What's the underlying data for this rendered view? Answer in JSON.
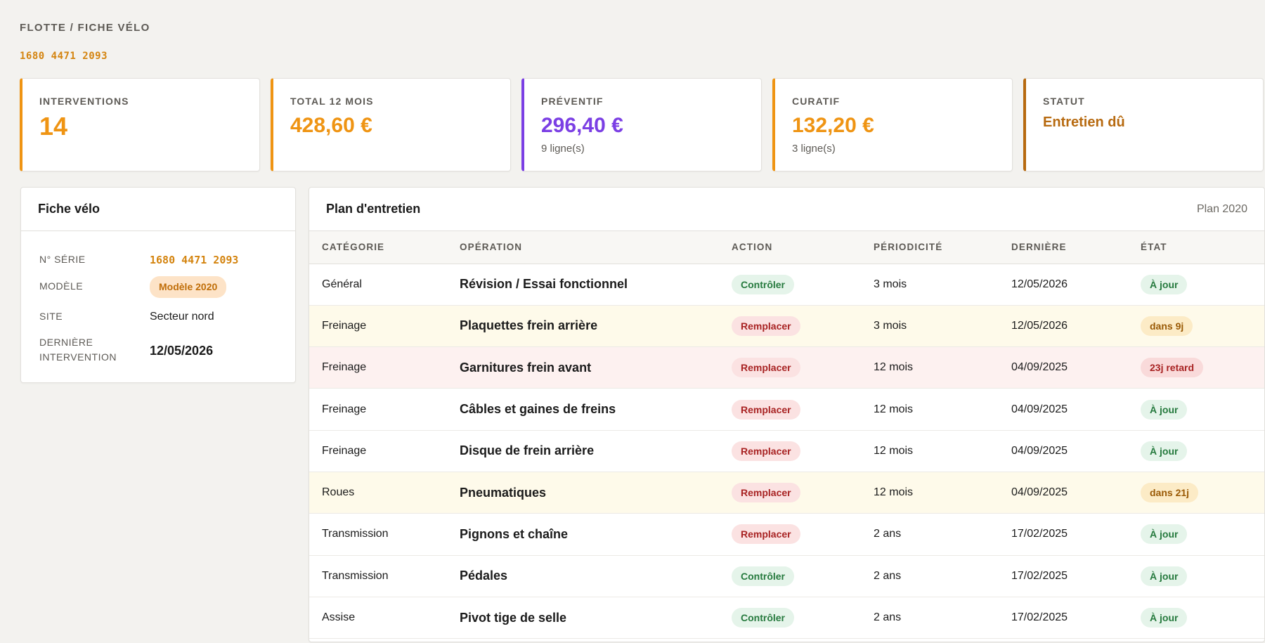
{
  "breadcrumb": "FLOTTE / FICHE VÉLO",
  "serial_header": "1680 4471 2093",
  "kpis": {
    "interventions": {
      "label": "INTERVENTIONS",
      "value": "14"
    },
    "total": {
      "label": "TOTAL 12 MOIS",
      "value": "428,60 €"
    },
    "preventif": {
      "label": "PRÉVENTIF",
      "value": "296,40 €",
      "sub": "9 ligne(s)"
    },
    "curatif": {
      "label": "CURATIF",
      "value": "132,20 €",
      "sub": "3 ligne(s)"
    },
    "statut": {
      "label": "STATUT",
      "value": "Entretien dû"
    }
  },
  "fiche": {
    "title": "Fiche vélo",
    "serie_label": "N° SÉRIE",
    "serie_value": "1680 4471 2093",
    "modele_label": "MODÈLE",
    "modele_value": "Modèle 2020",
    "site_label": "SITE",
    "site_value": "Secteur nord",
    "derniere_label": "DERNIÈRE INTERVENTION",
    "derniere_value": "12/05/2026"
  },
  "plan": {
    "title": "Plan d'entretien",
    "meta": "Plan 2020",
    "columns": [
      "CATÉGORIE",
      "OPÉRATION",
      "ACTION",
      "PÉRIODICITÉ",
      "DERNIÈRE",
      "ÉTAT"
    ],
    "rows": [
      {
        "categorie": "Général",
        "operation": "Révision / Essai fonctionnel",
        "action": "Contrôler",
        "periodicite": "3 mois",
        "derniere": "12/05/2026",
        "etat": "À jour"
      },
      {
        "categorie": "Freinage",
        "operation": "Plaquettes frein arrière",
        "action": "Remplacer",
        "periodicite": "3 mois",
        "derniere": "12/05/2026",
        "etat": "dans 9j"
      },
      {
        "categorie": "Freinage",
        "operation": "Garnitures frein avant",
        "action": "Remplacer",
        "periodicite": "12 mois",
        "derniere": "04/09/2025",
        "etat": "23j retard"
      },
      {
        "categorie": "Freinage",
        "operation": "Câbles et gaines de freins",
        "action": "Remplacer",
        "periodicite": "12 mois",
        "derniere": "04/09/2025",
        "etat": "À jour"
      },
      {
        "categorie": "Freinage",
        "operation": "Disque de frein arrière",
        "action": "Remplacer",
        "periodicite": "12 mois",
        "derniere": "04/09/2025",
        "etat": "À jour"
      },
      {
        "categorie": "Roues",
        "operation": "Pneumatiques",
        "action": "Remplacer",
        "periodicite": "12 mois",
        "derniere": "04/09/2025",
        "etat": "dans 21j"
      },
      {
        "categorie": "Transmission",
        "operation": "Pignons et chaîne",
        "action": "Remplacer",
        "periodicite": "2 ans",
        "derniere": "17/02/2025",
        "etat": "À jour"
      },
      {
        "categorie": "Transmission",
        "operation": "Pédales",
        "action": "Contrôler",
        "periodicite": "2 ans",
        "derniere": "17/02/2025",
        "etat": "À jour"
      },
      {
        "categorie": "Assise",
        "operation": "Pivot tige de selle",
        "action": "Contrôler",
        "periodicite": "2 ans",
        "derniere": "17/02/2025",
        "etat": "À jour"
      }
    ]
  },
  "colors": {
    "accent": "#ef9413",
    "preventif": "#7b3fe4",
    "statut": "#b76a10",
    "ok": "#267a3e",
    "danger": "#a82323"
  }
}
